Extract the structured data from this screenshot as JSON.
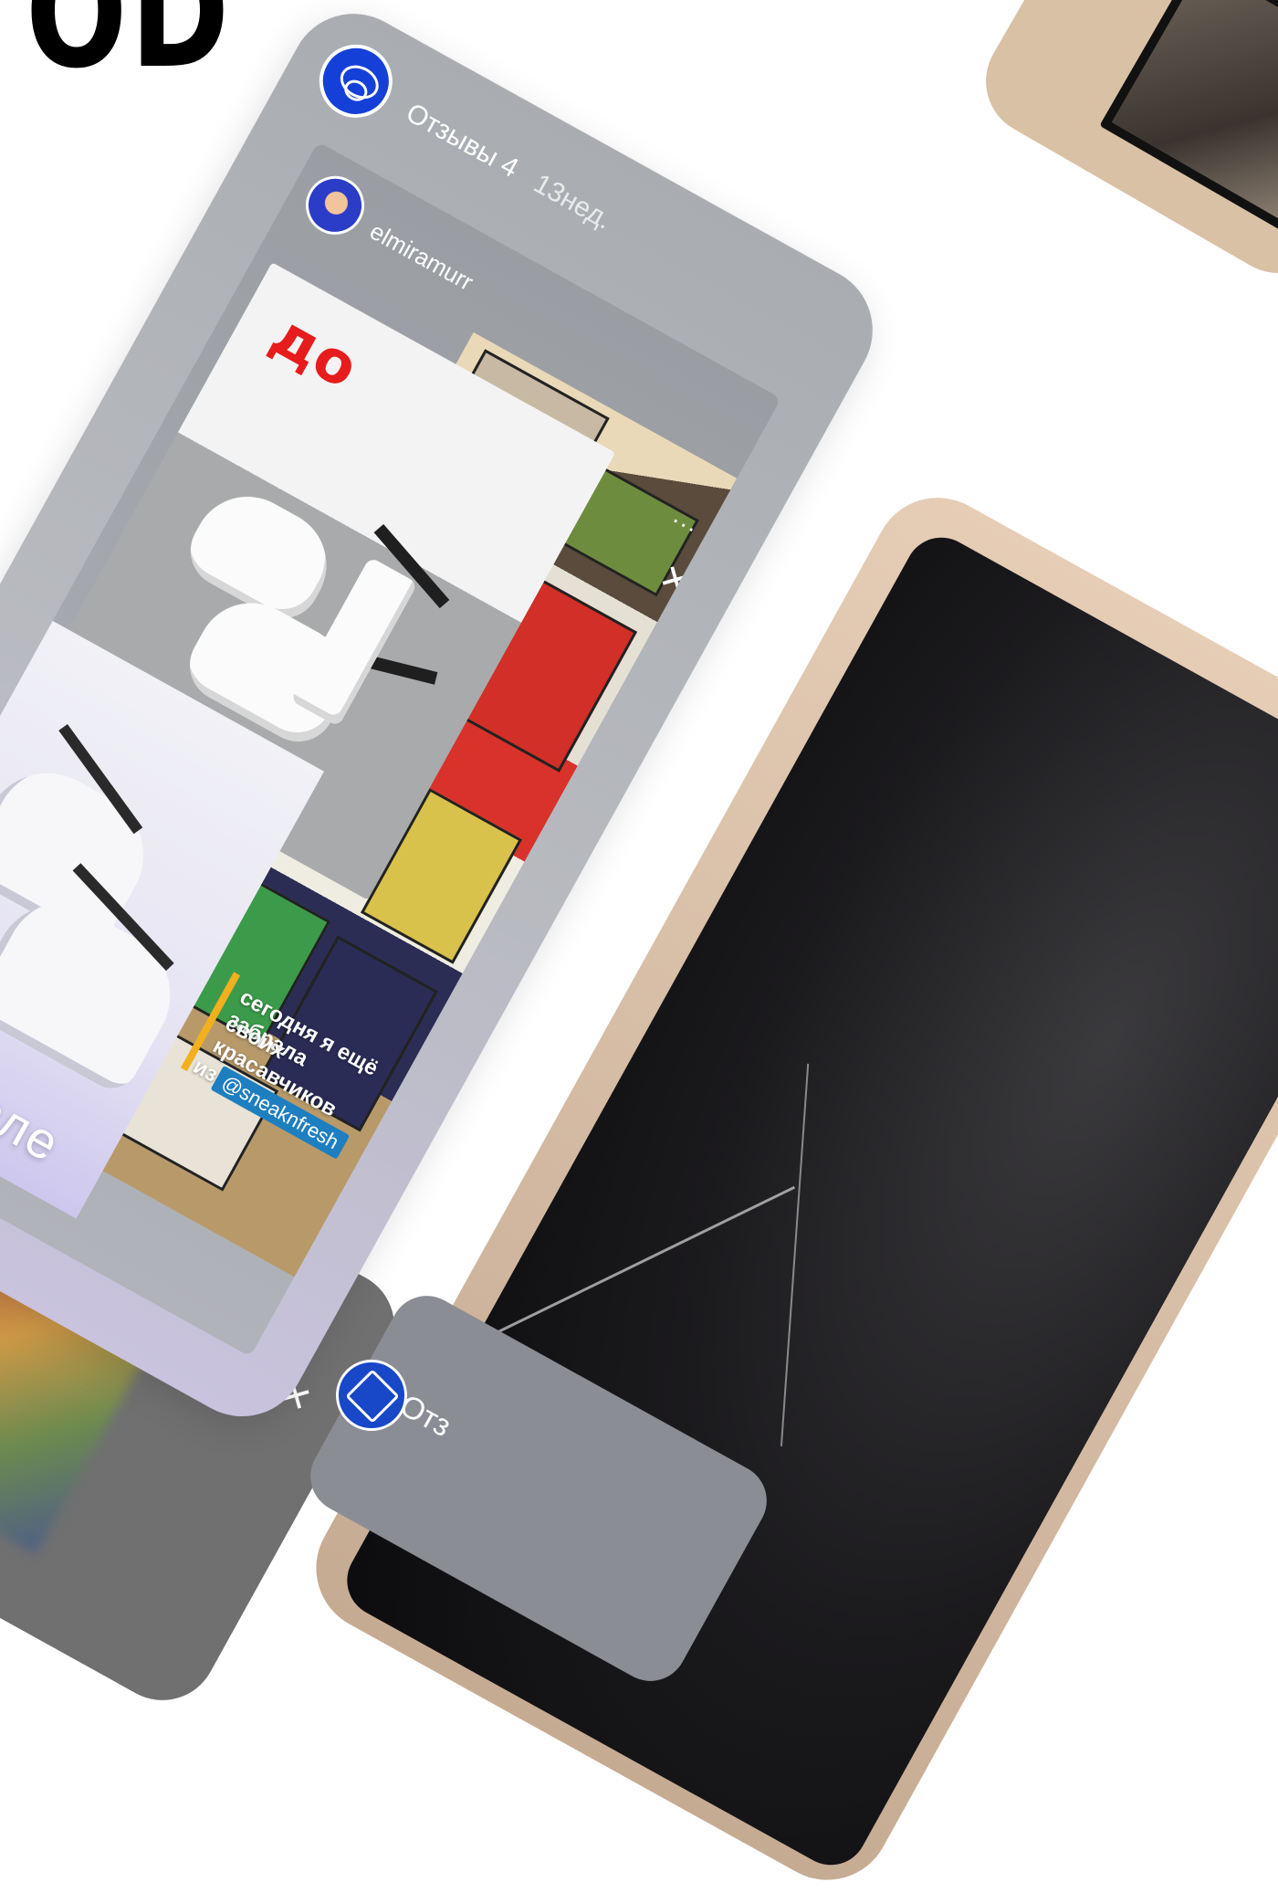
{
  "heading": "OD",
  "main_story": {
    "title": "Отзывы 4",
    "time": "13нед.",
    "inner": {
      "username": "elmiramurr",
      "menu": "...",
      "close": "×",
      "before_label": "до",
      "after_label": "После",
      "caption_line1": "сегодня я ещё забрала",
      "caption_line2": "своих красавчиков",
      "caption_line3": "из",
      "caption_mention": "@sneaknfresh"
    }
  },
  "bottom_left_card": {
    "menu": "...",
    "close": "×"
  },
  "bottom_center_card": {
    "title": "Отз"
  },
  "colors": {
    "before_label": "#e71c1c",
    "avatar_blue": "#1440d8",
    "mention_bg": "#1e7fc0",
    "caption_bar": "#f2b01e"
  }
}
